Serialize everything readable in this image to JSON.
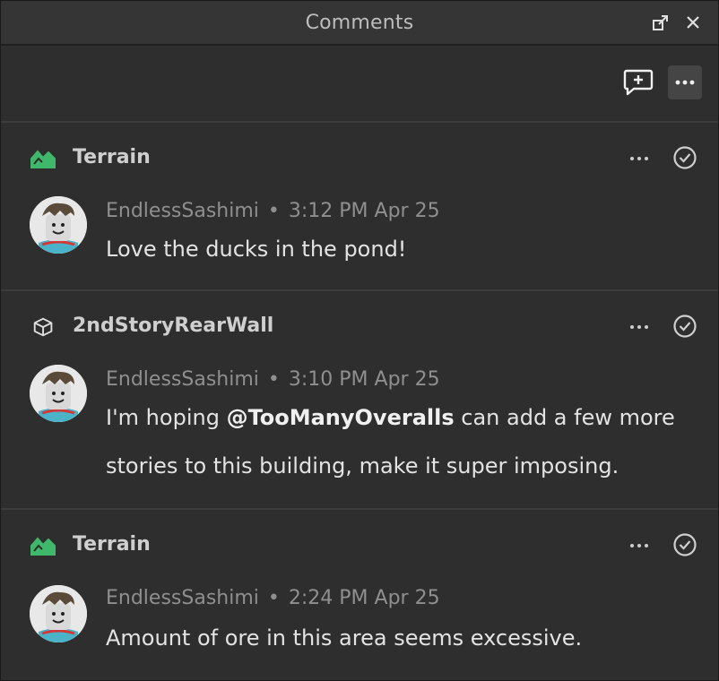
{
  "window": {
    "title": "Comments",
    "controls": [
      "restore-icon",
      "close-icon"
    ]
  },
  "toolbar": {
    "new_comment_icon": "comment-add-icon",
    "more_icon": "ellipsis-icon"
  },
  "threads": [
    {
      "object_icon": "terrain-icon",
      "object_name": "Terrain",
      "author": "EndlessSashimi",
      "time": "3:12 PM Apr 25",
      "body": "Love the ducks in the pond!"
    },
    {
      "object_icon": "part-cube-icon",
      "object_name": "2ndStoryRearWall",
      "author": "EndlessSashimi",
      "time": "3:10 PM Apr 25",
      "body_pre": "I'm hoping ",
      "mention": "@TooManyOveralls",
      "body_post": " can add a few more stories to this building, make it super imposing."
    },
    {
      "object_icon": "terrain-icon",
      "object_name": "Terrain",
      "author": "EndlessSashimi",
      "time": "2:24 PM Apr 25",
      "body": "Amount of ore in this area seems excessive."
    }
  ],
  "colors": {
    "background": "#2e2e2e",
    "titlebar": "#353535",
    "terrain_green": "#3fb86b",
    "text_primary": "#e3e3e3",
    "text_muted": "#8f8f8f"
  }
}
